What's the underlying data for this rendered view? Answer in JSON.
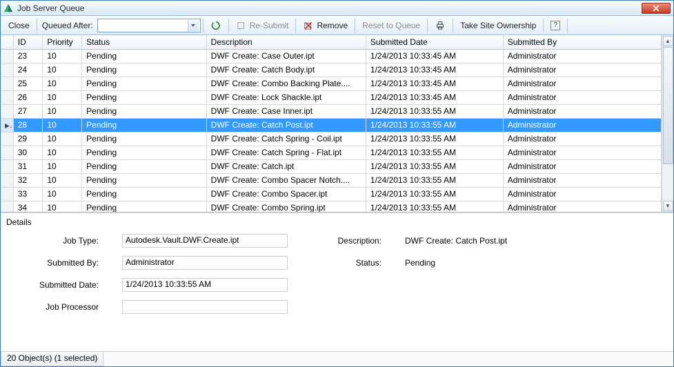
{
  "window": {
    "title": "Job Server Queue"
  },
  "toolbar": {
    "close": "Close",
    "queued_after_label": "Queued After:",
    "queued_after_value": "",
    "resubmit": "Re-Submit",
    "remove": "Remove",
    "reset": "Reset to Queue",
    "take_ownership": "Take Site Ownership",
    "help": "?"
  },
  "grid": {
    "columns": [
      "ID",
      "Priority",
      "Status",
      "Description",
      "Submitted Date",
      "Submitted By"
    ],
    "rows": [
      {
        "id": "23",
        "priority": "10",
        "status": "Pending",
        "desc": "DWF Create: Case Outer.ipt",
        "date": "1/24/2013 10:33:45 AM",
        "by": "Administrator",
        "selected": false
      },
      {
        "id": "24",
        "priority": "10",
        "status": "Pending",
        "desc": "DWF Create: Catch Body.ipt",
        "date": "1/24/2013 10:33:45 AM",
        "by": "Administrator",
        "selected": false
      },
      {
        "id": "25",
        "priority": "10",
        "status": "Pending",
        "desc": "DWF Create: Combo Backing Plate....",
        "date": "1/24/2013 10:33:45 AM",
        "by": "Administrator",
        "selected": false
      },
      {
        "id": "26",
        "priority": "10",
        "status": "Pending",
        "desc": "DWF Create: Lock Shackle.ipt",
        "date": "1/24/2013 10:33:45 AM",
        "by": "Administrator",
        "selected": false
      },
      {
        "id": "27",
        "priority": "10",
        "status": "Pending",
        "desc": "DWF Create: Case Inner.ipt",
        "date": "1/24/2013 10:33:55 AM",
        "by": "Administrator",
        "selected": false
      },
      {
        "id": "28",
        "priority": "10",
        "status": "Pending",
        "desc": "DWF Create: Catch Post.ipt",
        "date": "1/24/2013 10:33:55 AM",
        "by": "Administrator",
        "selected": true
      },
      {
        "id": "29",
        "priority": "10",
        "status": "Pending",
        "desc": "DWF Create: Catch Spring - Coil.ipt",
        "date": "1/24/2013 10:33:55 AM",
        "by": "Administrator",
        "selected": false
      },
      {
        "id": "30",
        "priority": "10",
        "status": "Pending",
        "desc": "DWF Create: Catch Spring - Flat.ipt",
        "date": "1/24/2013 10:33:55 AM",
        "by": "Administrator",
        "selected": false
      },
      {
        "id": "31",
        "priority": "10",
        "status": "Pending",
        "desc": "DWF Create: Catch.ipt",
        "date": "1/24/2013 10:33:55 AM",
        "by": "Administrator",
        "selected": false
      },
      {
        "id": "32",
        "priority": "10",
        "status": "Pending",
        "desc": "DWF Create: Combo Spacer Notch....",
        "date": "1/24/2013 10:33:55 AM",
        "by": "Administrator",
        "selected": false
      },
      {
        "id": "33",
        "priority": "10",
        "status": "Pending",
        "desc": "DWF Create: Combo Spacer.ipt",
        "date": "1/24/2013 10:33:55 AM",
        "by": "Administrator",
        "selected": false
      },
      {
        "id": "34",
        "priority": "10",
        "status": "Pending",
        "desc": "DWF Create: Combo Spring.ipt",
        "date": "1/24/2013 10:33:55 AM",
        "by": "Administrator",
        "selected": false
      }
    ]
  },
  "details": {
    "section": "Details",
    "labels": {
      "job_type": "Job Type:",
      "submitted_by": "Submitted By:",
      "submitted_date": "Submitted Date:",
      "job_processor": "Job Processor",
      "description": "Description:",
      "status": "Status:"
    },
    "values": {
      "job_type": "Autodesk.Vault.DWF.Create.ipt",
      "submitted_by": "Administrator",
      "submitted_date": "1/24/2013 10:33:55 AM",
      "job_processor": "",
      "description": "DWF Create: Catch Post.ipt",
      "status": "Pending"
    }
  },
  "statusbar": {
    "text": "20 Object(s) (1 selected)"
  }
}
